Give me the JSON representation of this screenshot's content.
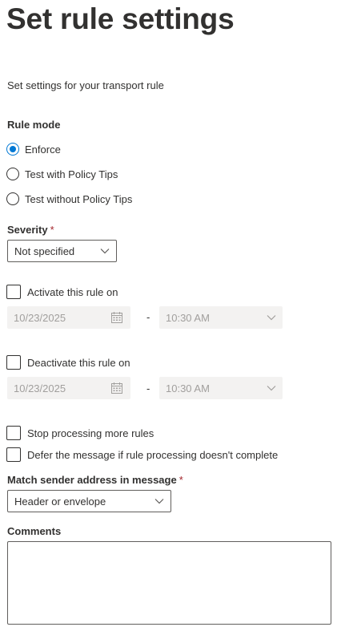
{
  "page": {
    "title": "Set rule settings",
    "description": "Set settings for your transport rule"
  },
  "rule_mode": {
    "label": "Rule mode",
    "options": [
      "Enforce",
      "Test with Policy Tips",
      "Test without Policy Tips"
    ],
    "selected": "Enforce"
  },
  "severity": {
    "label": "Severity",
    "required_marker": "*",
    "value": "Not specified"
  },
  "activate": {
    "label": "Activate this rule on",
    "checked": false,
    "date": "10/23/2025",
    "separator": "-",
    "time": "10:30 AM"
  },
  "deactivate": {
    "label": "Deactivate this rule on",
    "checked": false,
    "date": "10/23/2025",
    "separator": "-",
    "time": "10:30 AM"
  },
  "options": {
    "stop_processing": "Stop processing more rules",
    "defer_message": "Defer the message if rule processing doesn't complete"
  },
  "match_sender": {
    "label": "Match sender address in message",
    "required_marker": "*",
    "value": "Header or envelope"
  },
  "comments": {
    "label": "Comments",
    "value": ""
  },
  "colors": {
    "accent": "#0078d4",
    "required": "#a4262c",
    "text": "#323130",
    "disabled_bg": "#f3f2f1",
    "disabled_text": "#a19f9d"
  },
  "icons": [
    "calendar-icon",
    "chevron-down-icon"
  ]
}
